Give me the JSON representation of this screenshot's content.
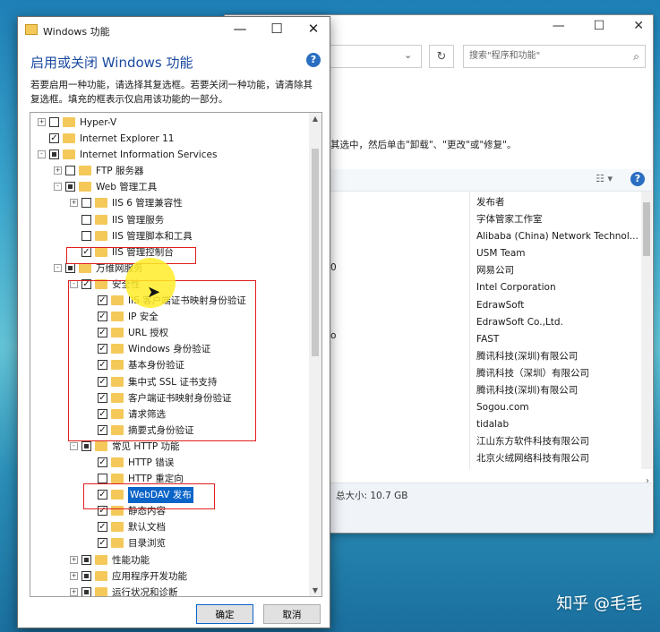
{
  "background_window": {
    "search_placeholder": "搜索\"程序和功能\"",
    "instruction": "其选中，然后单击\"卸载\"、\"更改\"或\"修复\"。",
    "left_fragments": [
      "0",
      "o"
    ],
    "publishers": [
      "发布者",
      "字体管家工作室",
      "Alibaba (China) Network Technol...",
      "USM Team",
      "网易公司",
      "Intel Corporation",
      "EdrawSoft",
      "EdrawSoft Co.,Ltd.",
      "FAST",
      "腾讯科技(深圳)有限公司",
      "腾讯科技（深圳）有限公司",
      "腾讯科技(深圳)有限公司",
      "Sogou.com",
      "tidalab",
      "江山东方软件科技有限公司",
      "北京火绒网络科技有限公司"
    ],
    "total_size": "总大小:  10.7 GB"
  },
  "dialog": {
    "title": "Windows 功能",
    "heading": "启用或关闭 Windows 功能",
    "description": "若要启用一种功能，请选择其复选框。若要关闭一种功能，请清除其复选框。填充的框表示仅启用该功能的一部分。",
    "ok_label": "确定",
    "cancel_label": "取消",
    "tree": [
      {
        "label": "Hyper-V",
        "level": 0,
        "expander": "+",
        "state": "off"
      },
      {
        "label": "Internet Explorer 11",
        "level": 0,
        "expander": "",
        "state": "on"
      },
      {
        "label": "Internet Information Services",
        "level": 0,
        "expander": "-",
        "state": "partial"
      },
      {
        "label": "FTP 服务器",
        "level": 1,
        "expander": "+",
        "state": "off"
      },
      {
        "label": "Web 管理工具",
        "level": 1,
        "expander": "-",
        "state": "partial"
      },
      {
        "label": "IIS 6 管理兼容性",
        "level": 2,
        "expander": "+",
        "state": "off"
      },
      {
        "label": "IIS 管理服务",
        "level": 2,
        "expander": "",
        "state": "off"
      },
      {
        "label": "IIS 管理脚本和工具",
        "level": 2,
        "expander": "",
        "state": "off"
      },
      {
        "label": "IIS 管理控制台",
        "level": 2,
        "expander": "",
        "state": "on"
      },
      {
        "label": "万维网服务",
        "level": 1,
        "expander": "-",
        "state": "partial"
      },
      {
        "label": "安全性",
        "level": 2,
        "expander": "-",
        "state": "on"
      },
      {
        "label": "IIS 客户端证书映射身份验证",
        "level": 3,
        "expander": "",
        "state": "on"
      },
      {
        "label": "IP 安全",
        "level": 3,
        "expander": "",
        "state": "on"
      },
      {
        "label": "URL 授权",
        "level": 3,
        "expander": "",
        "state": "on"
      },
      {
        "label": "Windows 身份验证",
        "level": 3,
        "expander": "",
        "state": "on"
      },
      {
        "label": "基本身份验证",
        "level": 3,
        "expander": "",
        "state": "on"
      },
      {
        "label": "集中式 SSL 证书支持",
        "level": 3,
        "expander": "",
        "state": "on"
      },
      {
        "label": "客户端证书映射身份验证",
        "level": 3,
        "expander": "",
        "state": "on"
      },
      {
        "label": "请求筛选",
        "level": 3,
        "expander": "",
        "state": "on"
      },
      {
        "label": "摘要式身份验证",
        "level": 3,
        "expander": "",
        "state": "on"
      },
      {
        "label": "常见 HTTP 功能",
        "level": 2,
        "expander": "-",
        "state": "partial"
      },
      {
        "label": "HTTP 错误",
        "level": 3,
        "expander": "",
        "state": "on"
      },
      {
        "label": "HTTP 重定向",
        "level": 3,
        "expander": "",
        "state": "off"
      },
      {
        "label": "WebDAV 发布",
        "level": 3,
        "expander": "",
        "state": "on",
        "selected": true
      },
      {
        "label": "静态内容",
        "level": 3,
        "expander": "",
        "state": "on"
      },
      {
        "label": "默认文档",
        "level": 3,
        "expander": "",
        "state": "on"
      },
      {
        "label": "目录浏览",
        "level": 3,
        "expander": "",
        "state": "on"
      },
      {
        "label": "性能功能",
        "level": 2,
        "expander": "+",
        "state": "partial"
      },
      {
        "label": "应用程序开发功能",
        "level": 2,
        "expander": "+",
        "state": "partial"
      },
      {
        "label": "运行状况和诊断",
        "level": 2,
        "expander": "+",
        "state": "partial"
      }
    ]
  },
  "watermark": "知乎 @毛毛",
  "colors": {
    "accent": "#0a64c8",
    "heading": "#1b4aa0",
    "highlight_box": "#e02020",
    "folder": "#f4c95a"
  }
}
